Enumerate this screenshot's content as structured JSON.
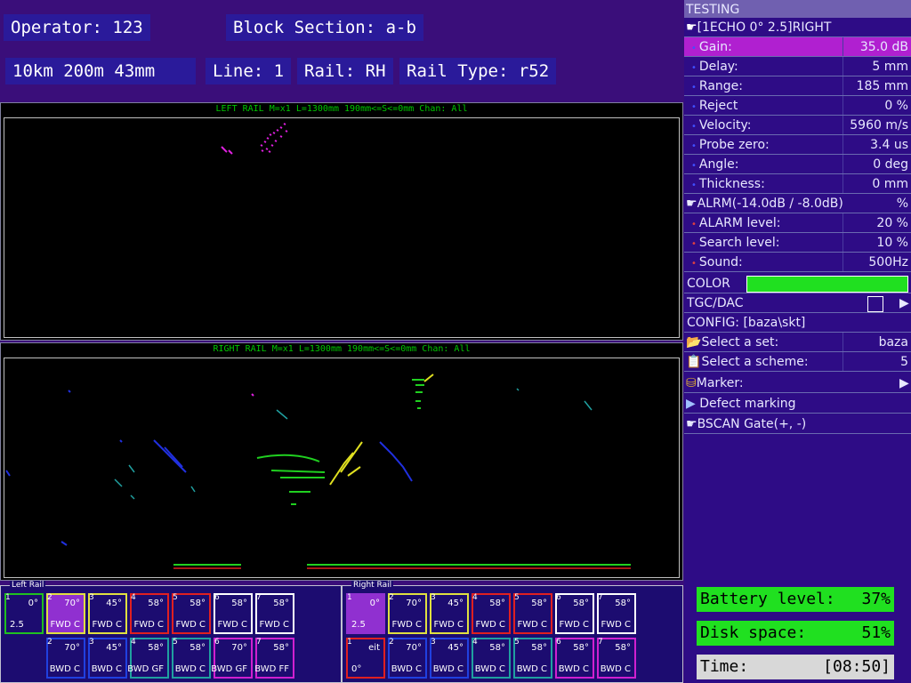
{
  "header": {
    "operator": "Operator: 123",
    "block_section": "Block Section: a-b",
    "distance": "10km 200m  43mm",
    "line": "Line: 1",
    "rail": "Rail: RH",
    "rail_type": "Rail Type: r52"
  },
  "scans": {
    "left_title": "LEFT RAIL M=x1  L=1300mm 190mm<=S<=0mm Chan: All",
    "right_title": "RIGHT RAIL M=x1  L=1300mm 190mm<=S<=0mm Chan: All"
  },
  "panel": {
    "title": "TESTING",
    "echo_header": "[1ECHO 0° 2.5]RIGHT",
    "params": [
      {
        "label": "Gain:",
        "value": "35.0 dB"
      },
      {
        "label": "Delay:",
        "value": "5 mm"
      },
      {
        "label": "Range:",
        "value": "185 mm"
      },
      {
        "label": "Reject",
        "value": "0 %"
      },
      {
        "label": "Velocity:",
        "value": "5960 m/s"
      },
      {
        "label": "Probe zero:",
        "value": "3.4 us"
      },
      {
        "label": "Angle:",
        "value": "0 deg"
      },
      {
        "label": "Thickness:",
        "value": "0 mm"
      }
    ],
    "alarm_header": "ALRM(-14.0dB / -8.0dB)",
    "alarm_unit": "%",
    "alarm_params": [
      {
        "label": "ALARM level:",
        "value": "20 %"
      },
      {
        "label": "Search level:",
        "value": "10 %"
      },
      {
        "label": "Sound:",
        "value": "500Hz"
      }
    ],
    "color_label": "COLOR",
    "color_swatch": "#20e020",
    "tgc_label": "TGC/DAC",
    "config_label": "CONFIG: [baza\\skt]",
    "select_set": {
      "label": "Select a set:",
      "value": "baza"
    },
    "select_scheme": {
      "label": "Select a scheme:",
      "value": "5"
    },
    "marker": "Marker:",
    "defect_marking": "Defect marking",
    "bscan_gate": "BSCAN Gate(+, -)"
  },
  "left_rail": {
    "title": "Left Rail",
    "top": [
      {
        "num": "1",
        "angle": "0°",
        "mode": "2.5",
        "color": "#20c020",
        "fill": ""
      },
      {
        "num": "2",
        "angle": "70°",
        "mode": "FWD C",
        "color": "#e0e040",
        "fill": "#9030d0"
      },
      {
        "num": "3",
        "angle": "45°",
        "mode": "FWD C",
        "color": "#e0e040",
        "fill": ""
      },
      {
        "num": "4",
        "angle": "58°",
        "mode": "FWD C",
        "color": "#e02020",
        "fill": ""
      },
      {
        "num": "5",
        "angle": "58°",
        "mode": "FWD C",
        "color": "#e02020",
        "fill": ""
      },
      {
        "num": "6",
        "angle": "58°",
        "mode": "FWD C",
        "color": "#ffffff",
        "fill": ""
      },
      {
        "num": "7",
        "angle": "58°",
        "mode": "FWD C",
        "color": "#ffffff",
        "fill": ""
      }
    ],
    "bottom": [
      {
        "num": "2",
        "angle": "70°",
        "mode": "BWD C",
        "color": "#2040e0",
        "fill": ""
      },
      {
        "num": "3",
        "angle": "45°",
        "mode": "BWD C",
        "color": "#2040e0",
        "fill": ""
      },
      {
        "num": "4",
        "angle": "58°",
        "mode": "BWD GF",
        "color": "#20a0a0",
        "fill": ""
      },
      {
        "num": "5",
        "angle": "58°",
        "mode": "BWD C",
        "color": "#20a0a0",
        "fill": ""
      },
      {
        "num": "6",
        "angle": "70°",
        "mode": "BWD GF",
        "color": "#d020d0",
        "fill": ""
      },
      {
        "num": "7",
        "angle": "58°",
        "mode": "BWD FF",
        "color": "#d020d0",
        "fill": ""
      }
    ]
  },
  "right_rail": {
    "title": "Right Rail",
    "top": [
      {
        "num": "1",
        "angle": "0°",
        "mode": "2.5",
        "color": "#9030d0",
        "fill": "#9030d0"
      },
      {
        "num": "2",
        "angle": "70°",
        "mode": "FWD C",
        "color": "#e0e040",
        "fill": ""
      },
      {
        "num": "3",
        "angle": "45°",
        "mode": "FWD C",
        "color": "#e0e040",
        "fill": ""
      },
      {
        "num": "4",
        "angle": "58°",
        "mode": "FWD C",
        "color": "#e02020",
        "fill": ""
      },
      {
        "num": "5",
        "angle": "58°",
        "mode": "FWD C",
        "color": "#e02020",
        "fill": ""
      },
      {
        "num": "6",
        "angle": "58°",
        "mode": "FWD C",
        "color": "#ffffff",
        "fill": ""
      },
      {
        "num": "7",
        "angle": "58°",
        "mode": "FWD C",
        "color": "#ffffff",
        "fill": ""
      }
    ],
    "bottom": [
      {
        "num": "1",
        "angle": "eit",
        "mode": "0°",
        "color": "#e02020",
        "fill": ""
      },
      {
        "num": "2",
        "angle": "70°",
        "mode": "BWD C",
        "color": "#2040e0",
        "fill": ""
      },
      {
        "num": "3",
        "angle": "45°",
        "mode": "BWD C",
        "color": "#2040e0",
        "fill": ""
      },
      {
        "num": "4",
        "angle": "58°",
        "mode": "BWD C",
        "color": "#20a0a0",
        "fill": ""
      },
      {
        "num": "5",
        "angle": "58°",
        "mode": "BWD C",
        "color": "#20a0a0",
        "fill": ""
      },
      {
        "num": "6",
        "angle": "58°",
        "mode": "BWD C",
        "color": "#d020d0",
        "fill": ""
      },
      {
        "num": "7",
        "angle": "58°",
        "mode": "BWD C",
        "color": "#d020d0",
        "fill": ""
      }
    ]
  },
  "status": {
    "battery_label": "Battery level:",
    "battery_value": "37%",
    "disk_label": "Disk space:",
    "disk_value": "51%",
    "time_label": "Time:",
    "time_value": "[08:50]"
  }
}
